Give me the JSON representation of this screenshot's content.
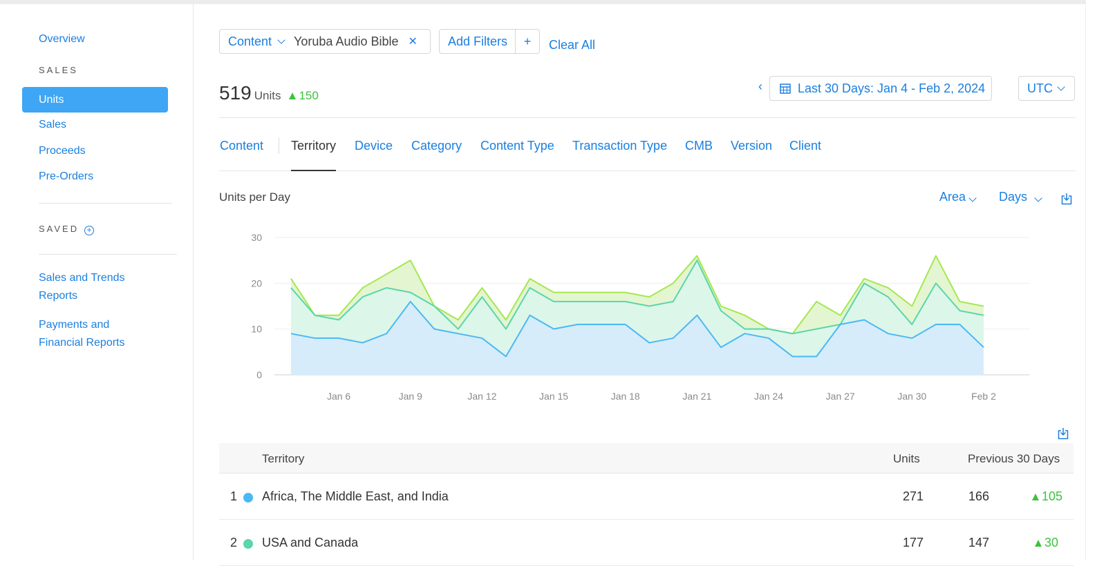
{
  "sidebar": {
    "overview": "Overview",
    "sales_heading": "SALES",
    "items": [
      {
        "label": "Units",
        "active": true
      },
      {
        "label": "Sales"
      },
      {
        "label": "Proceeds"
      },
      {
        "label": "Pre-Orders"
      }
    ],
    "saved_heading": "SAVED",
    "reports": [
      {
        "line1": "Sales and Trends",
        "line2": "Reports"
      },
      {
        "line1": "Payments and",
        "line2": "Financial Reports"
      }
    ]
  },
  "filters": {
    "content_label": "Content",
    "content_value": "Yoruba Audio Bible",
    "add_filters": "Add Filters",
    "plus": "+",
    "clear_all": "Clear All"
  },
  "summary": {
    "total": "519",
    "unit_label": "Units",
    "delta": "150",
    "date_range": "Last 30 Days: Jan 4 - Feb 2, 2024",
    "timezone": "UTC"
  },
  "tabs": [
    {
      "label": "Content"
    },
    {
      "label": "Territory",
      "active": true
    },
    {
      "label": "Device"
    },
    {
      "label": "Category"
    },
    {
      "label": "Content Type"
    },
    {
      "label": "Transaction Type"
    },
    {
      "label": "CMB"
    },
    {
      "label": "Version"
    },
    {
      "label": "Client"
    }
  ],
  "chart_controls": {
    "title": "Units per Day",
    "chart_type": "Area",
    "interval": "Days"
  },
  "chart_data": {
    "type": "area",
    "title": "Units per Day",
    "x": [
      "Jan 4",
      "Jan 5",
      "Jan 6",
      "Jan 7",
      "Jan 8",
      "Jan 9",
      "Jan 10",
      "Jan 11",
      "Jan 12",
      "Jan 13",
      "Jan 14",
      "Jan 15",
      "Jan 16",
      "Jan 17",
      "Jan 18",
      "Jan 19",
      "Jan 20",
      "Jan 21",
      "Jan 22",
      "Jan 23",
      "Jan 24",
      "Jan 25",
      "Jan 26",
      "Jan 27",
      "Jan 28",
      "Jan 29",
      "Jan 30",
      "Jan 31",
      "Feb 1",
      "Feb 2"
    ],
    "x_tick_labels": [
      "Jan 6",
      "Jan 9",
      "Jan 12",
      "Jan 15",
      "Jan 18",
      "Jan 21",
      "Jan 24",
      "Jan 27",
      "Jan 30",
      "Feb 2"
    ],
    "y_ticks": [
      0,
      10,
      20,
      30
    ],
    "ylim": [
      0,
      30
    ],
    "stacked": true,
    "series": [
      {
        "name": "Africa, The Middle East, and India",
        "color": "#4ab8f5",
        "fill": "#d6ecfb",
        "values": [
          9,
          8,
          8,
          7,
          9,
          16,
          10,
          9,
          8,
          4,
          13,
          10,
          11,
          11,
          11,
          7,
          8,
          13,
          6,
          9,
          8,
          4,
          4,
          11,
          12,
          9,
          8,
          11,
          11,
          6
        ]
      },
      {
        "name": "USA and Canada",
        "color": "#5ad6a8",
        "fill": "#dcf6ea",
        "values": [
          10,
          5,
          4,
          10,
          10,
          2,
          5,
          1,
          9,
          6,
          6,
          6,
          5,
          5,
          5,
          8,
          8,
          12,
          8,
          1,
          2,
          5,
          6,
          0,
          8,
          8,
          3,
          9,
          3,
          7
        ]
      },
      {
        "color": "#a4e84e",
        "fill": "#e4f5d2",
        "values": [
          2,
          0,
          1,
          2,
          3,
          7,
          0,
          2,
          2,
          2,
          2,
          2,
          2,
          2,
          2,
          2,
          4,
          1,
          1,
          3,
          0,
          0,
          6,
          2,
          1,
          2,
          4,
          6,
          2,
          2
        ]
      }
    ]
  },
  "table": {
    "headers": {
      "territory": "Territory",
      "units": "Units",
      "previous": "Previous 30 Days"
    },
    "rows": [
      {
        "rank": "1",
        "color": "#4ab8f5",
        "name": "Africa, The Middle East, and India",
        "units": "271",
        "previous": "166",
        "change": "105"
      },
      {
        "rank": "2",
        "color": "#5ad6a8",
        "name": "USA and Canada",
        "units": "177",
        "previous": "147",
        "change": "30"
      }
    ]
  }
}
